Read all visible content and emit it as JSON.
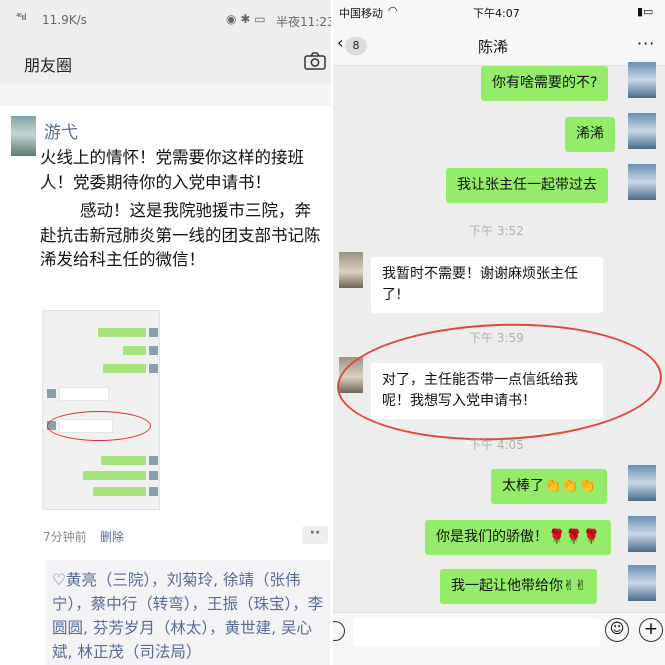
{
  "moments": {
    "status": {
      "signal": "⁴⁶ııl",
      "speed": "11.9K/s",
      "time": "半夜11:23"
    },
    "title": "朋友圈",
    "post": {
      "user": "游弋",
      "text1": "火线上的情怀！党需要你这样的接班人！党委期待你的入党申请书！",
      "text2": "感动！这是我院驰援市三院，奔赴抗击新冠肺炎第一线的团支部书记陈浠发给科主任的微信！",
      "time_ago": "7分钟前",
      "delete_label": "删除",
      "more_label": "··",
      "likes": "♡黄亮（三院），刘菊玲, 徐靖（张伟宁），蔡中行（转弯），王振（珠宝），李圆圆, 芬芳岁月（林太），黄世建, 吴心斌, 林正茂（司法局）"
    }
  },
  "chat": {
    "status": {
      "carrier": "中国移动",
      "time": "下午4:07"
    },
    "back_badge": "8",
    "contact": "陈浠",
    "more": "···",
    "messages": {
      "m1": "你有啥需要的不?",
      "m2": "浠浠",
      "m3": "我让张主任一起带过去",
      "ts1": "下午 3:52",
      "m4": "我暂时不需要！谢谢麻烦张主任了!",
      "ts2": "下午 3:59",
      "m5": "对了，主任能否带一点信纸给我呢！我想写入党申请书！",
      "ts3": "下午 4:05",
      "m6": "太棒了👏👏👏",
      "m7": "你是我们的骄傲！🌹🌹🌹",
      "m8": "我一起让他带给你✌✌"
    }
  },
  "colors": {
    "sent_bubble": "#95ec69",
    "link_blue": "#576b95",
    "annotation_red": "#e0483f"
  }
}
